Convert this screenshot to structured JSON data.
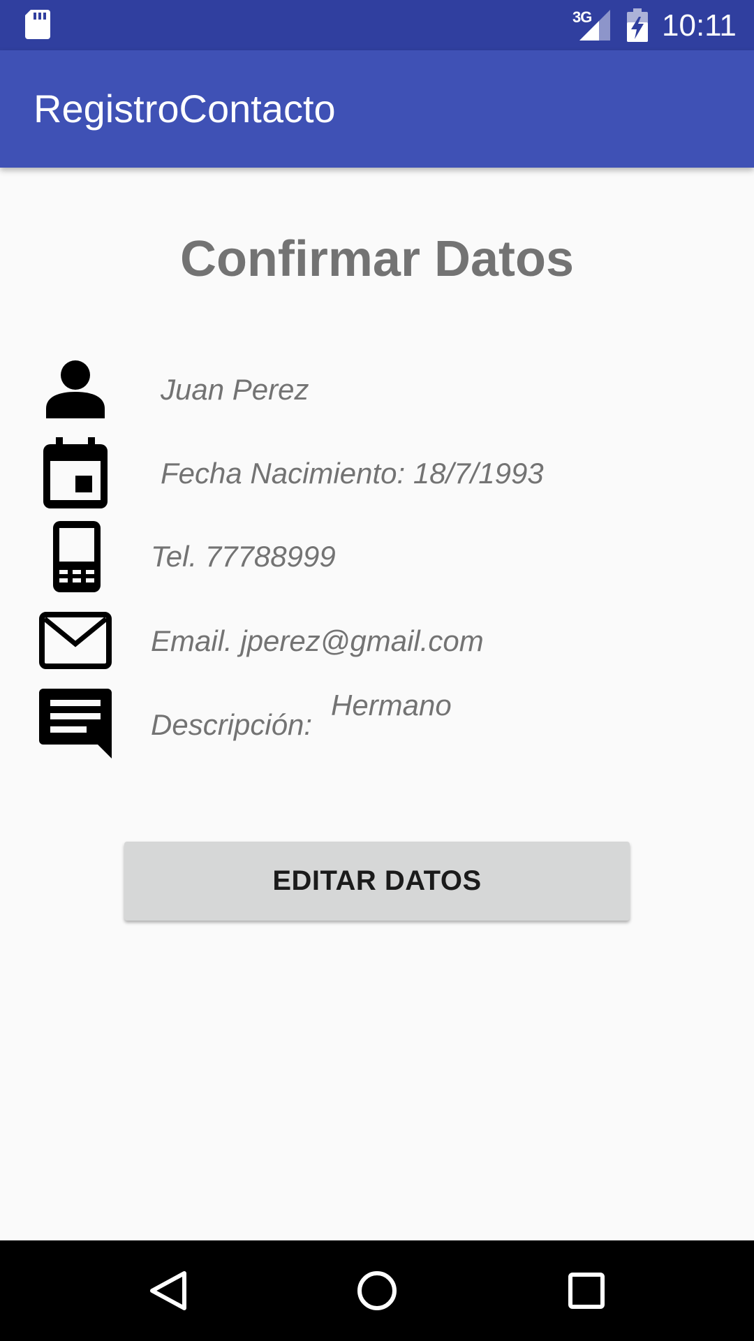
{
  "status_bar": {
    "network": "3G",
    "time": "10:11",
    "icons": [
      "sd-card-icon",
      "cell-signal-icon",
      "battery-charging-icon"
    ]
  },
  "app_bar": {
    "title": "RegistroContacto"
  },
  "main": {
    "heading": "Confirmar Datos",
    "rows": [
      {
        "icon": "person-icon",
        "text": "Juan Perez"
      },
      {
        "icon": "calendar-icon",
        "text": "Fecha Nacimiento: 18/7/1993"
      },
      {
        "icon": "mobile-phone-icon",
        "text": "Tel.  77788999"
      },
      {
        "icon": "email-icon",
        "text": "Email.  jperez@gmail.com"
      },
      {
        "icon": "comment-icon",
        "label": "Descripción:",
        "value": "Hermano"
      }
    ],
    "edit_button_label": "EDITAR DATOS"
  },
  "nav_bar": {
    "icons": [
      "back-icon",
      "home-icon",
      "recents-icon"
    ]
  },
  "colors": {
    "status_bar": "#303f9f",
    "app_bar": "#3f51b5",
    "background": "#fafafa",
    "text_gray": "#737373",
    "button": "#d6d7d7"
  }
}
